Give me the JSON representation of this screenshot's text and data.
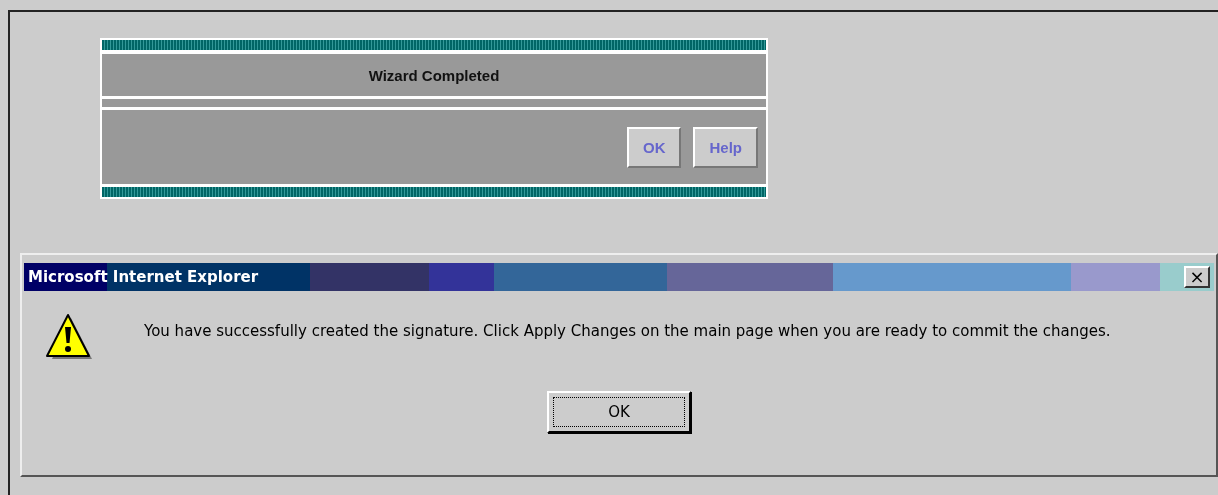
{
  "wizard": {
    "title": "Wizard Completed",
    "buttons": [
      {
        "label": "OK"
      },
      {
        "label": "Help"
      }
    ]
  },
  "dialog": {
    "title": "Microsoft Internet Explorer",
    "close_button": "×",
    "message": "You have successfully created the signature. Click Apply Changes on the main page when you are ready to commit the changes.",
    "button": {
      "label": "OK",
      "focused": true
    }
  }
}
